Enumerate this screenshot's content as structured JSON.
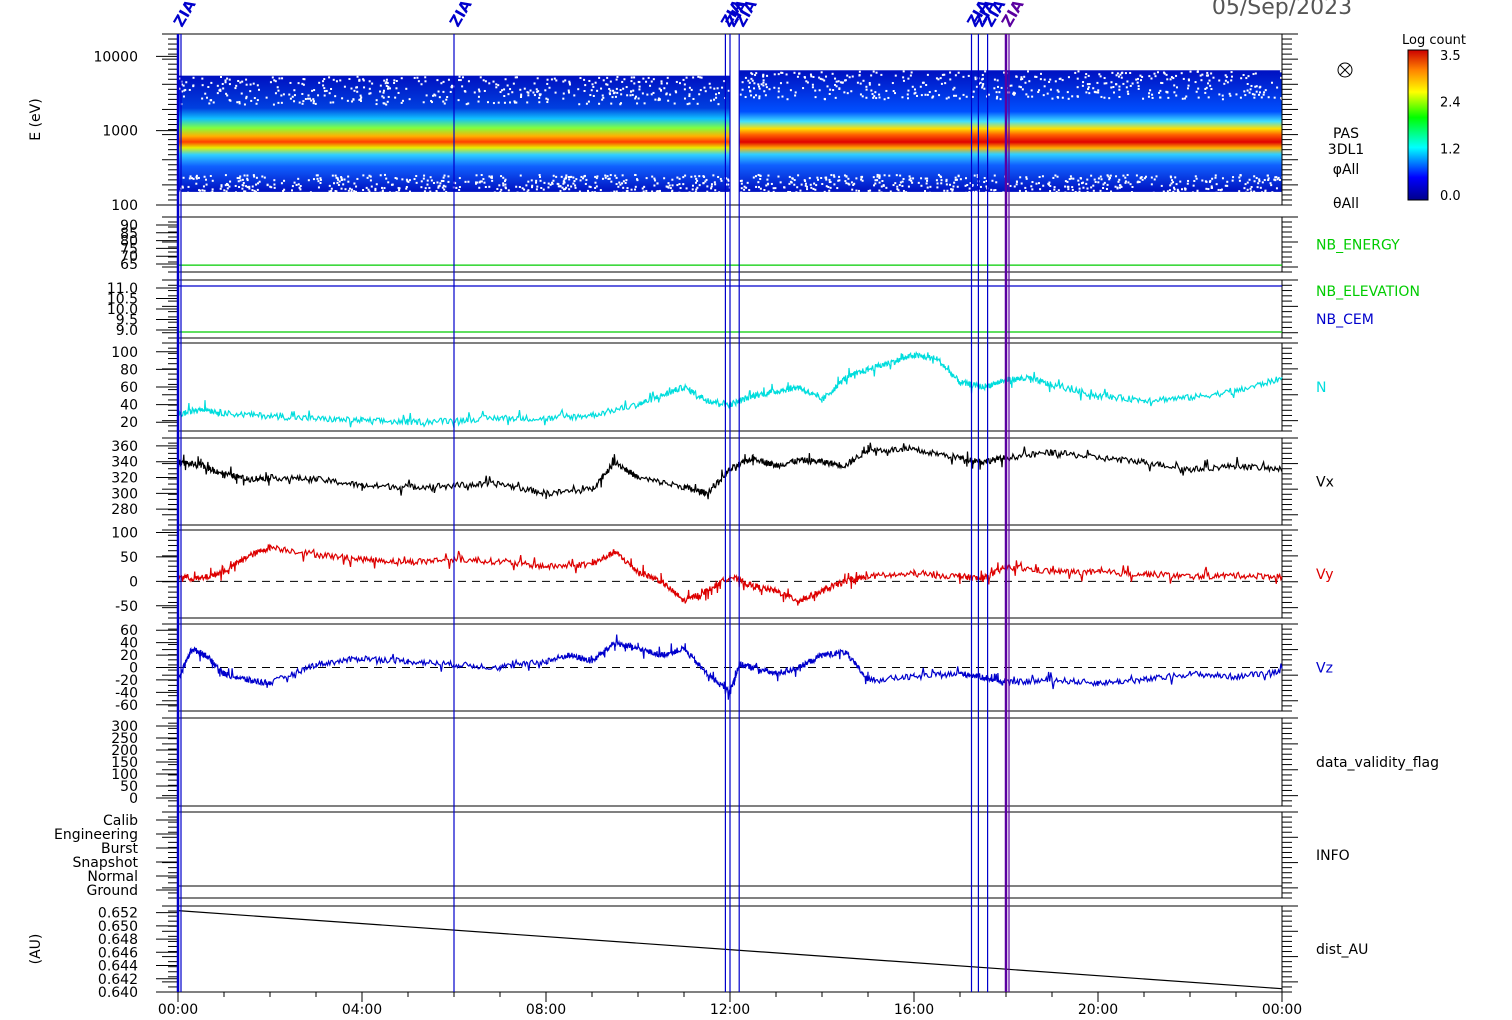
{
  "page_title": "05/Sep/2023",
  "colorbar": {
    "label": "Log count",
    "ticks": [
      "3.5",
      "2.4",
      "1.2",
      "0.0"
    ]
  },
  "time_axis": {
    "tick_labels": [
      "00:00",
      "04:00",
      "08:00",
      "12:00",
      "16:00",
      "20:00",
      "00:00"
    ],
    "range_hours": [
      0,
      24
    ]
  },
  "event_markers": {
    "label": "ZIA",
    "times_hours": [
      0.0,
      6.0,
      11.9,
      12.0,
      12.2,
      17.25,
      17.4,
      17.6,
      18.0
    ],
    "colors": [
      "#0000cc",
      "#0000cc",
      "#0000cc",
      "#0000cc",
      "#0000cc",
      "#0000cc",
      "#0000cc",
      "#0000cc",
      "#5a00a0"
    ]
  },
  "chart_data": [
    {
      "type": "heatmap",
      "ylabel": "E (eV)",
      "y_scale": "log",
      "ylim": [
        100,
        20000
      ],
      "y_ticks": [
        "10000",
        "1000",
        "100"
      ],
      "right_labels": [
        "PAS",
        "3DL1",
        "φAll",
        "θAll"
      ],
      "icon": "circled-x-icon",
      "colorbar_range": [
        0.0,
        3.5
      ],
      "bands": [
        {
          "x_range": [
            0,
            12
          ],
          "core_energy_eV": 600,
          "core_level": 3.0,
          "outer_range_eV": [
            150,
            5500
          ]
        },
        {
          "x_range": [
            12.2,
            24
          ],
          "core_energy_eV": 650,
          "core_level": 3.4,
          "outer_range_eV": [
            150,
            6500
          ]
        }
      ]
    },
    {
      "type": "line",
      "y_ticks": [
        "90",
        "85",
        "80",
        "75",
        "70",
        "65"
      ],
      "series": [
        {
          "name": "NB_ENERGY",
          "color": "#00cc00",
          "x": [
            0,
            24
          ],
          "y": [
            65.5,
            65.5
          ]
        }
      ]
    },
    {
      "type": "line",
      "y_ticks": [
        "11.0",
        "10.5",
        "10.0",
        "9.5",
        "9.0"
      ],
      "series": [
        {
          "name": "NB_ELEVATION",
          "color": "#00cc00",
          "x": [
            0,
            24
          ],
          "y": [
            9.0,
            9.0
          ]
        },
        {
          "name": "NB_CEM",
          "color": "#0000cc",
          "x": [
            0,
            24
          ],
          "y": [
            11.0,
            11.0
          ]
        }
      ]
    },
    {
      "type": "line",
      "ylim": [
        10,
        110
      ],
      "y_ticks": [
        "100",
        "80",
        "60",
        "40",
        "20"
      ],
      "series": [
        {
          "name": "N",
          "color": "#00dddd",
          "x": [
            0,
            0.5,
            1,
            2,
            3,
            4,
            5,
            6,
            7,
            8,
            9,
            10,
            10.5,
            11,
            11.5,
            12,
            12.5,
            13,
            13.5,
            14,
            14.5,
            15,
            15.5,
            16,
            16.5,
            17,
            17.5,
            18,
            18.5,
            19,
            20,
            21,
            22,
            23,
            24
          ],
          "y": [
            28,
            36,
            30,
            27,
            24,
            22,
            20,
            22,
            25,
            24,
            28,
            40,
            50,
            60,
            45,
            40,
            50,
            55,
            60,
            45,
            70,
            80,
            88,
            96,
            92,
            65,
            60,
            68,
            70,
            62,
            50,
            45,
            48,
            55,
            70
          ]
        }
      ]
    },
    {
      "type": "line",
      "ylim": [
        260,
        370
      ],
      "y_ticks": [
        "360",
        "340",
        "320",
        "300",
        "280"
      ],
      "series": [
        {
          "name": "Vx",
          "color": "#000000",
          "x": [
            0,
            0.5,
            1,
            1.5,
            2,
            3,
            4,
            5,
            6,
            7,
            8,
            9,
            9.5,
            10,
            11,
            11.5,
            12,
            12.5,
            13,
            13.5,
            14,
            14.5,
            15,
            16,
            17,
            17.5,
            18,
            19,
            20,
            21,
            22,
            23,
            24
          ],
          "y": [
            340,
            335,
            325,
            318,
            320,
            318,
            310,
            308,
            310,
            312,
            300,
            305,
            340,
            320,
            308,
            300,
            330,
            345,
            335,
            342,
            340,
            335,
            355,
            355,
            345,
            340,
            345,
            352,
            345,
            340,
            330,
            335,
            330
          ]
        }
      ]
    },
    {
      "type": "line",
      "ylim": [
        -75,
        105
      ],
      "y_ticks": [
        "100",
        "50",
        "0",
        "-50"
      ],
      "dashed_zero": true,
      "series": [
        {
          "name": "Vy",
          "color": "#dd0000",
          "x": [
            0,
            0.5,
            1,
            1.5,
            2,
            3,
            4,
            5,
            6,
            7,
            8,
            9,
            9.5,
            10,
            10.5,
            11,
            11.5,
            12,
            12.5,
            13,
            13.5,
            14,
            14.5,
            15,
            16,
            17,
            17.5,
            18,
            19,
            20,
            21,
            22,
            23,
            24
          ],
          "y": [
            10,
            5,
            20,
            50,
            70,
            55,
            45,
            40,
            45,
            40,
            30,
            35,
            60,
            20,
            0,
            -40,
            -20,
            10,
            -10,
            -20,
            -40,
            -20,
            0,
            10,
            15,
            10,
            5,
            30,
            20,
            18,
            15,
            10,
            12,
            10
          ]
        }
      ]
    },
    {
      "type": "line",
      "ylim": [
        -70,
        70
      ],
      "y_ticks": [
        "60",
        "40",
        "20",
        "0",
        "-20",
        "-40",
        "-60"
      ],
      "dashed_zero": true,
      "series": [
        {
          "name": "Vz",
          "color": "#0000cc",
          "x": [
            0,
            0.3,
            0.6,
            1,
            1.5,
            2,
            3,
            4,
            5,
            6,
            7,
            8,
            8.5,
            9,
            9.5,
            10,
            10.5,
            11,
            11.5,
            12,
            12.2,
            12.5,
            13,
            13.5,
            14,
            14.5,
            15,
            16,
            17,
            17.5,
            18,
            19,
            20,
            21,
            22,
            23,
            24
          ],
          "y": [
            -20,
            30,
            20,
            -10,
            -20,
            -25,
            5,
            15,
            10,
            5,
            0,
            10,
            20,
            10,
            40,
            30,
            20,
            30,
            -10,
            -40,
            5,
            0,
            -10,
            0,
            20,
            25,
            -20,
            -15,
            -10,
            -15,
            -25,
            -20,
            -25,
            -20,
            -10,
            -15,
            -5
          ]
        }
      ]
    },
    {
      "type": "line",
      "y_ticks": [
        "300",
        "250",
        "200",
        "150",
        "100",
        "50",
        "0"
      ],
      "series": [
        {
          "name": "data_validity_flag",
          "color": "#000000",
          "x": [],
          "y": []
        }
      ]
    },
    {
      "type": "line",
      "categories": [
        "Calib",
        "Engineering",
        "Burst",
        "Snapshot",
        "Normal",
        "Ground"
      ],
      "series": [
        {
          "name": "INFO",
          "color": "#000000",
          "x": [],
          "y": []
        }
      ]
    },
    {
      "type": "line",
      "ylabel": "(AU)",
      "ylim": [
        0.64,
        0.653
      ],
      "y_ticks": [
        "0.652",
        "0.650",
        "0.648",
        "0.646",
        "0.644",
        "0.642",
        "0.640"
      ],
      "series": [
        {
          "name": "dist_AU",
          "color": "#000000",
          "x": [
            0,
            24
          ],
          "y": [
            0.6523,
            0.6405
          ]
        }
      ]
    }
  ]
}
